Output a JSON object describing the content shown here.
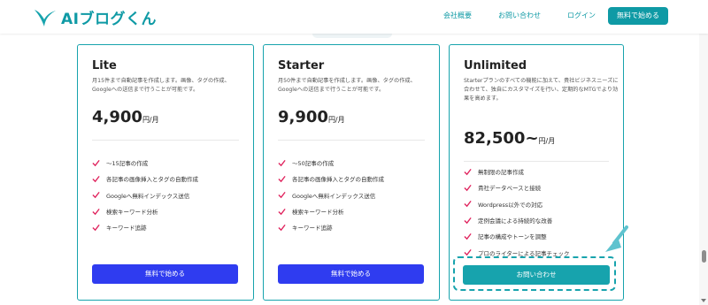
{
  "header": {
    "brand": "AIブログくん",
    "nav": [
      "会社概要",
      "お問い合わせ",
      "ログイン"
    ],
    "cta": "無料で始める"
  },
  "plans": [
    {
      "name": "Lite",
      "description": "月15件まで自動記事を作成します。画像、タグの作成、Googleへの送信まで行うことが可能です。",
      "price": "4,900",
      "unit": "円/月",
      "features": [
        "〜15記事の作成",
        "各記事の画像挿入とタグの自動作成",
        "Googleへ無料インデックス送信",
        "検索キーワード分析",
        "キーワード追跡"
      ],
      "button": "無料で始める"
    },
    {
      "name": "Starter",
      "description": "月50件まで自動記事を作成します。画像、タグの作成、Googleへの送信まで行うことが可能です。",
      "price": "9,900",
      "unit": "円/月",
      "features": [
        "〜50記事の作成",
        "各記事の画像挿入とタグの自動作成",
        "Googleへ無料インデックス送信",
        "検索キーワード分析",
        "キーワード追跡"
      ],
      "button": "無料で始める"
    },
    {
      "name": "Unlimited",
      "description": "Starterプランのすべての機能に加えて、貴社ビジネスニーズに合わせて、独自にカスタマイズを行い、定期的なMTGでより効果を高めます。",
      "price": "82,500~",
      "unit": "円/月",
      "features": [
        "無制限の記事作成",
        "貴社データベースと接続",
        "Wordpress以外での対応",
        "定例会議による持続的な改善",
        "記事の構成やトーンを調整",
        "プロのライターによる記事チェック"
      ],
      "button": "お問い合わせ"
    }
  ],
  "colors": {
    "brand_teal": "#17a3ad",
    "primary_blue": "#2f3cf0",
    "check_red": "#e0245e"
  }
}
